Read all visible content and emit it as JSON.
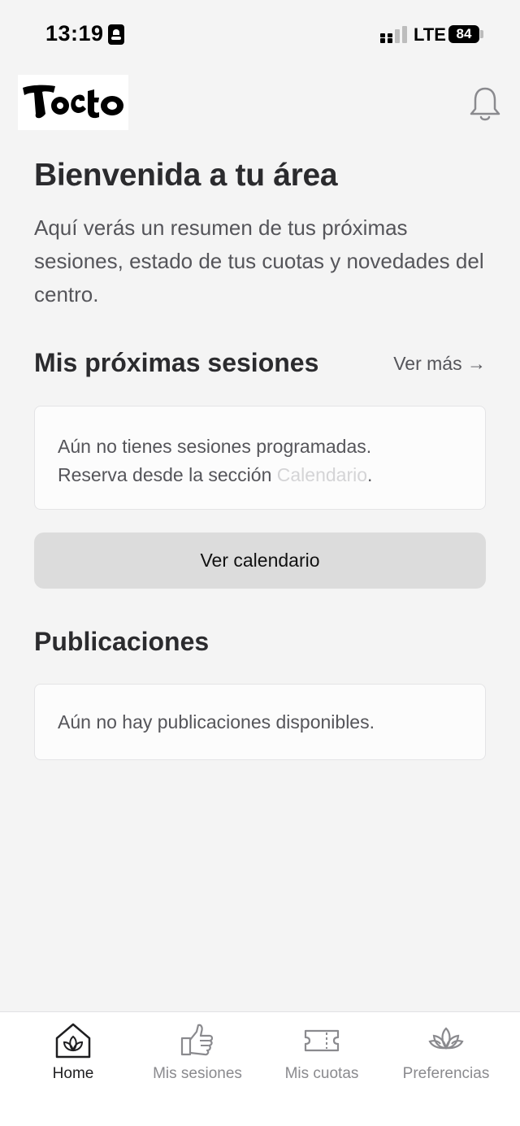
{
  "status_bar": {
    "time": "13:19",
    "network": "LTE",
    "battery": "84",
    "icons": [
      "id-card-icon",
      "signal-icon",
      "battery-icon"
    ]
  },
  "header": {
    "logo_text": "Tacto",
    "logo_icon": "tacto-logo",
    "notification_icon": "bell-icon"
  },
  "main": {
    "title": "Bienvenida a tu área",
    "intro": "Aquí verás un resumen de tus próximas sesiones, estado de tus cuotas y novedades del centro.",
    "sessions": {
      "title": "Mis próximas sesiones",
      "see_more": "Ver más →",
      "empty_line1": "Aún no tienes sesiones programadas.",
      "empty_line2_prefix": "Reserva desde la sección ",
      "empty_line2_link": "Calendario",
      "empty_line2_suffix": ".",
      "button_label": "Ver calendario"
    },
    "posts": {
      "title": "Publicaciones",
      "empty": "Aún no hay publicaciones disponibles."
    }
  },
  "tab_bar": {
    "items": [
      {
        "label": "Home",
        "icon": "home-leaf-icon",
        "active": true
      },
      {
        "label": "Mis sesiones",
        "icon": "hand-icon",
        "active": false
      },
      {
        "label": "Mis cuotas",
        "icon": "ticket-icon",
        "active": false
      },
      {
        "label": "Preferencias",
        "icon": "lotus-icon",
        "active": false
      }
    ]
  },
  "colors": {
    "background": "#f4f4f4",
    "title_text": "#2b2b2e",
    "body_text": "#55555a",
    "link_muted": "#d4d4d6",
    "button_bg": "#dcdcdc",
    "tab_inactive": "#8a8a8e",
    "tab_active": "#1e1e20"
  }
}
